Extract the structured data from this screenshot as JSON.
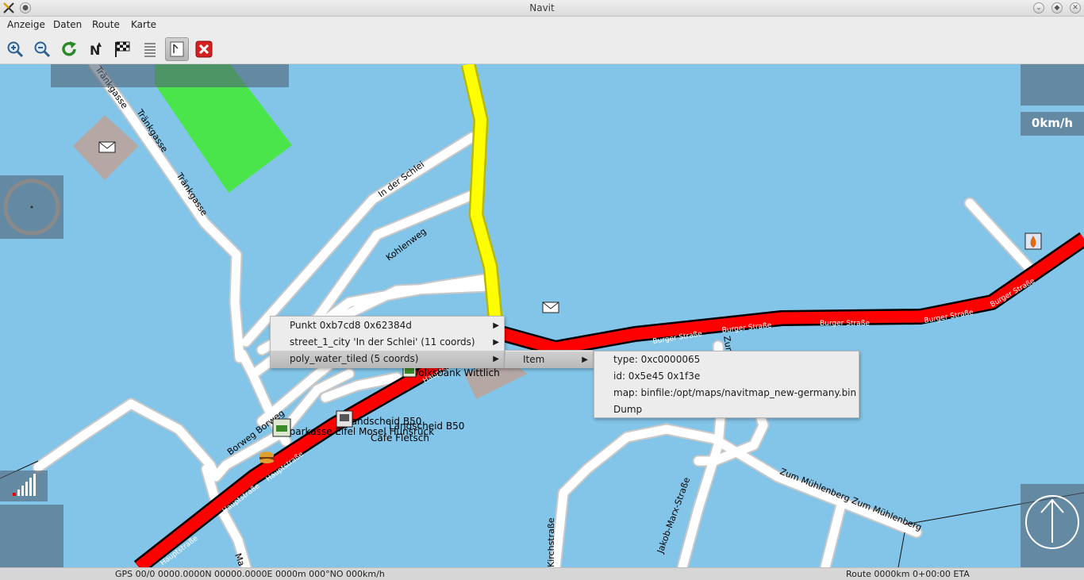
{
  "window": {
    "title": "Navit"
  },
  "menu": {
    "items": [
      "Anzeige",
      "Daten",
      "Route",
      "Karte"
    ]
  },
  "toolbar": {
    "buttons": [
      "zoom-in-icon",
      "zoom-out-icon",
      "refresh-icon",
      "north-orientation-icon",
      "destination-flag-icon",
      "roadbook-icon",
      "layout-toggle-icon",
      "quit-icon"
    ]
  },
  "map": {
    "streets": {
      "traenkgasse_top": "Tränkgasse",
      "traenkgasse_a": "Tränkgasse",
      "traenkgasse_b": "Tränkgasse",
      "in_der_schlei": "In der Schlei",
      "kohlenweg": "Kohlenweg",
      "burger1": "Burger Straße",
      "burger2": "Burger Straße",
      "burger3": "Burger Straße",
      "burger4": "Burger Straße",
      "burger5": "Burger Straße",
      "haupt1": "Hauptstraße",
      "haupt2": "Hauptstraße",
      "haupt3": "Hauptstraße",
      "haupt4": "Hauptstraße",
      "borweg": "Borweg  Borweg",
      "muehlenberg": "Zum Mühlenberg Zum Mühlenberg",
      "jakob": "Jakob-Marx-Straße",
      "kirchstr": "Kirchstraße",
      "zum": "Zum",
      "ma": "Ma"
    },
    "pois": {
      "volksbank": "Volksbank Wittlich",
      "landscheid1": "Landscheid B50",
      "landscheid2": "Landscheid B50",
      "sparkasse": "Sparkasse Eifel Mosel Hunsrück",
      "cafe": "Cafe Fletsch"
    },
    "speed": "0km/h"
  },
  "context_menu": {
    "items": [
      "Punkt 0xb7cd8 0x62384d",
      "street_1_city 'In der Schlei' (11 coords)",
      "poly_water_tiled (5 coords)"
    ],
    "selected": "poly_water_tiled (5 coords)"
  },
  "submenu": {
    "item": "Item"
  },
  "detail_menu": {
    "items": [
      "type: 0xc0000065",
      "id: 0x5e45 0x1f3e",
      "map: binfile:/opt/maps/navitmap_new-germany.bin",
      "Dump"
    ]
  },
  "status": {
    "gps": "GPS 00/0 0000.0000N 00000.0000E 0000m 000°NO 000km/h",
    "route": "Route 0000km 0+00:00 ETA"
  },
  "colors": {
    "water": "#83c5e9",
    "main_road": "#ff0000",
    "highlight_road": "#ffff00",
    "park": "#4ae54a",
    "building": "#b5a7a4"
  }
}
